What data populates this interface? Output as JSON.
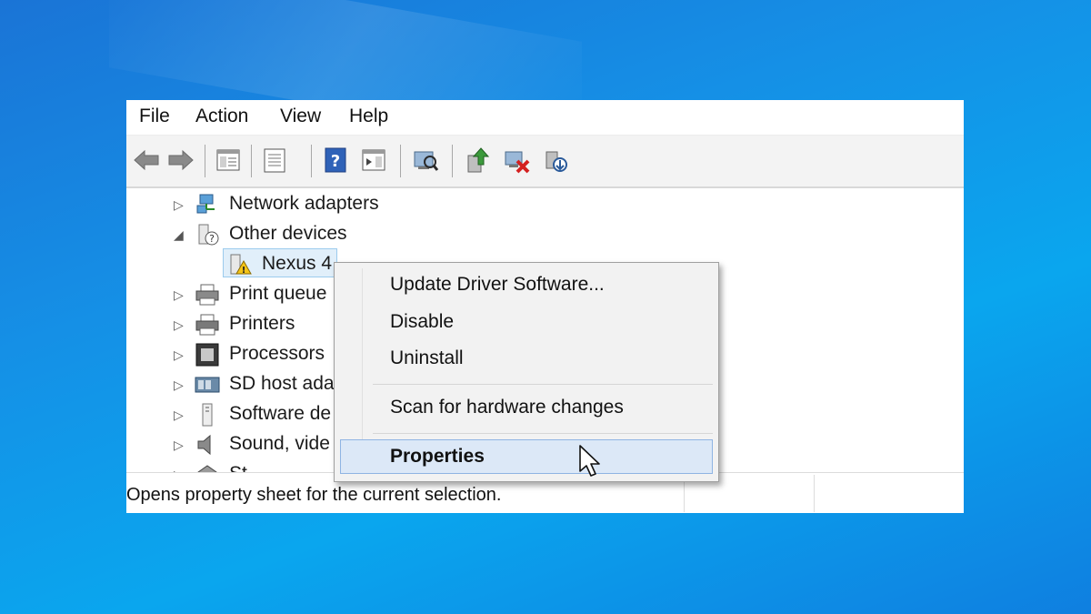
{
  "menubar": {
    "items": [
      "File",
      "Action",
      "View",
      "Help"
    ]
  },
  "toolbar": {
    "buttons": [
      "back-icon",
      "forward-icon",
      "console-tree-icon",
      "properties-icon",
      "help-icon",
      "action-pane-icon",
      "scan-hardware-icon",
      "update-driver-icon",
      "uninstall-device-icon",
      "enable-device-icon"
    ]
  },
  "tree": {
    "rows": [
      {
        "label": "Network adapters",
        "expander": "▷",
        "icon": "network-adapter-icon"
      },
      {
        "label": "Other devices",
        "expander": "◢",
        "icon": "unknown-device-icon"
      },
      {
        "label": "Nexus 4",
        "expander": "",
        "icon": "warning-device-icon"
      },
      {
        "label": "Print queue",
        "expander": "▷",
        "icon": "print-queue-icon"
      },
      {
        "label": "Printers",
        "expander": "▷",
        "icon": "printer-icon"
      },
      {
        "label": "Processors",
        "expander": "▷",
        "icon": "processor-icon"
      },
      {
        "label": "SD host ada",
        "expander": "▷",
        "icon": "sd-host-icon"
      },
      {
        "label": "Software de",
        "expander": "▷",
        "icon": "software-device-icon"
      },
      {
        "label": "Sound, vide",
        "expander": "▷",
        "icon": "sound-icon"
      },
      {
        "label": "St",
        "expander": "▷",
        "icon": "storage-icon"
      }
    ]
  },
  "context_menu": {
    "items": [
      {
        "label": "Update Driver Software..."
      },
      {
        "label": "Disable"
      },
      {
        "label": "Uninstall"
      },
      {
        "label": "Scan for hardware changes"
      },
      {
        "label": "Properties",
        "highlighted": true
      }
    ]
  },
  "statusbar": {
    "text": "Opens property sheet for the current selection."
  },
  "colors": {
    "desktop": "#1590e6",
    "selection": "#dce8f7",
    "selection_border": "#8fb4e3"
  }
}
